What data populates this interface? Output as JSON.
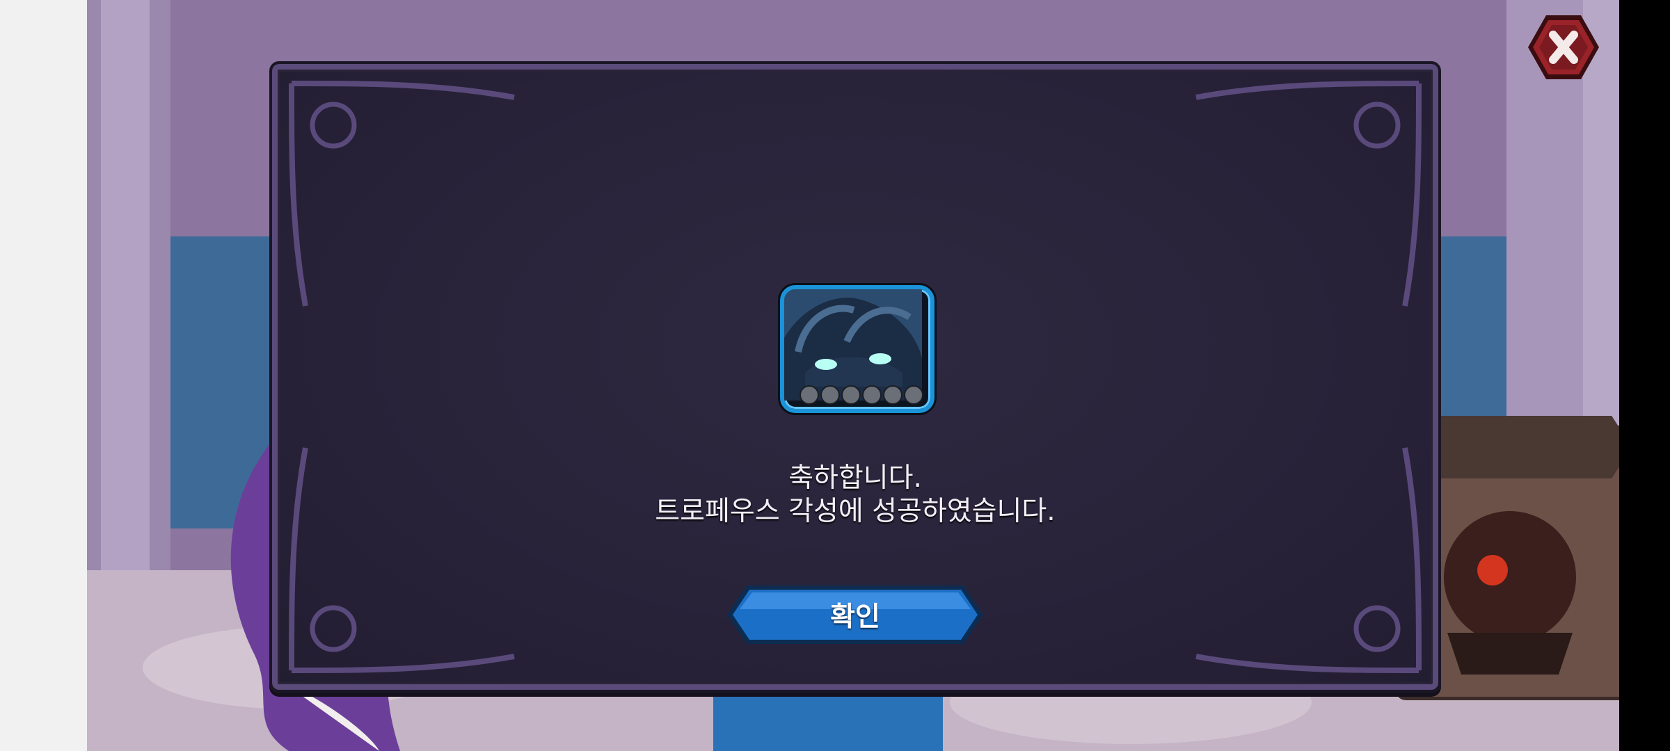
{
  "dialog": {
    "message_line1": "축하합니다.",
    "message_line2": "트로페우스 각성에 성공하였습니다.",
    "confirm_label": "확인",
    "awakening_slots": 6
  },
  "icons": {
    "close": "close-icon",
    "creature": "dragon-portrait-icon"
  },
  "colors": {
    "dialog_bg": "#2a2438",
    "dialog_border": "#5b4b7b",
    "button_blue": "#1c6fc6",
    "close_red": "#8b1f25"
  }
}
